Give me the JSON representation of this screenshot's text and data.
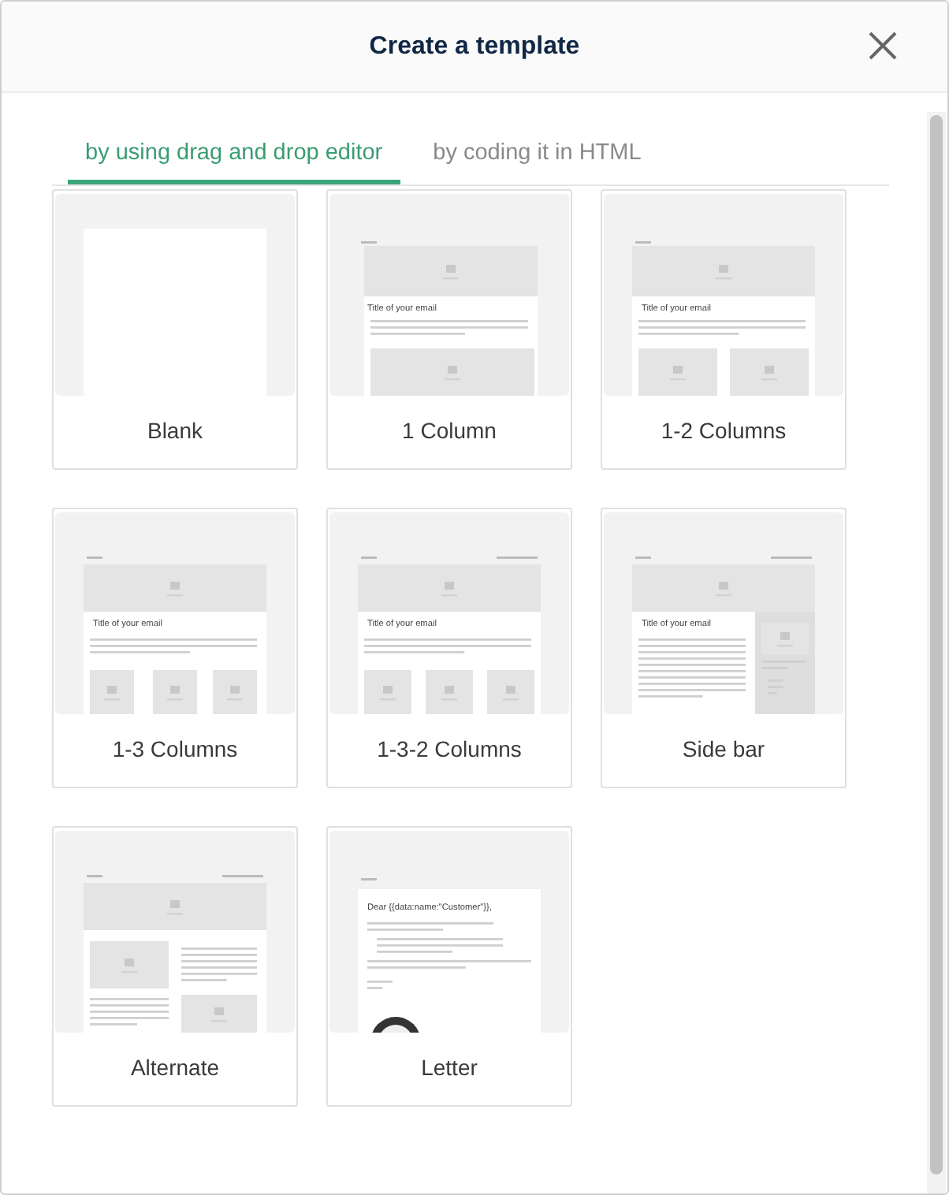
{
  "dialog": {
    "title": "Create a template"
  },
  "tabs": [
    {
      "label": "by using drag and drop editor",
      "selected": true
    },
    {
      "label": "by coding it in HTML",
      "selected": false
    }
  ],
  "templates": [
    {
      "name": "Blank",
      "kind": "blank"
    },
    {
      "name": "1 Column",
      "kind": "one_column",
      "preview_title": "Title of your email"
    },
    {
      "name": "1-2 Columns",
      "kind": "two_columns",
      "preview_title": "Title of your email"
    },
    {
      "name": "1-3 Columns",
      "kind": "three_columns",
      "preview_title": "Title of your email"
    },
    {
      "name": "1-3-2 Columns",
      "kind": "three_two_columns",
      "preview_title": "Title of your email"
    },
    {
      "name": "Side bar",
      "kind": "sidebar",
      "preview_title": "Title of your email"
    },
    {
      "name": "Alternate",
      "kind": "alternate"
    },
    {
      "name": "Letter",
      "kind": "letter",
      "preview_title": "Dear {{data:name:\"Customer\"}},"
    }
  ]
}
